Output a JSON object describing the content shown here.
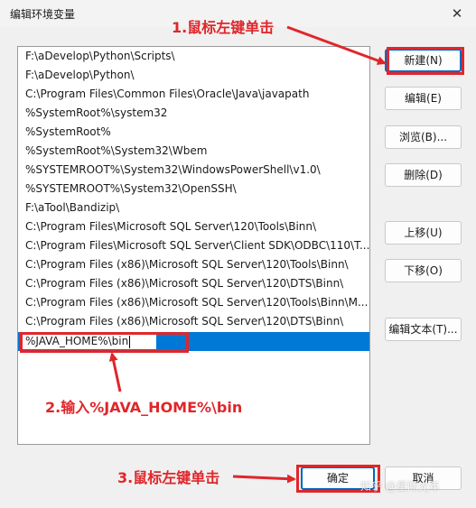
{
  "window": {
    "title": "编辑环境变量",
    "close_glyph": "✕"
  },
  "paths": [
    "F:\\aDevelop\\Python\\Scripts\\",
    "F:\\aDevelop\\Python\\",
    "C:\\Program Files\\Common Files\\Oracle\\Java\\javapath",
    "%SystemRoot%\\system32",
    "%SystemRoot%",
    "%SystemRoot%\\System32\\Wbem",
    "%SYSTEMROOT%\\System32\\WindowsPowerShell\\v1.0\\",
    "%SYSTEMROOT%\\System32\\OpenSSH\\",
    "F:\\aTool\\Bandizip\\",
    "C:\\Program Files\\Microsoft SQL Server\\120\\Tools\\Binn\\",
    "C:\\Program Files\\Microsoft SQL Server\\Client SDK\\ODBC\\110\\T...",
    "C:\\Program Files (x86)\\Microsoft SQL Server\\120\\Tools\\Binn\\",
    "C:\\Program Files (x86)\\Microsoft SQL Server\\120\\DTS\\Binn\\",
    "C:\\Program Files (x86)\\Microsoft SQL Server\\120\\Tools\\Binn\\M...",
    "C:\\Program Files (x86)\\Microsoft SQL Server\\120\\DTS\\Binn\\"
  ],
  "editing_row": {
    "value": "%JAVA_HOME%\\bin"
  },
  "buttons": {
    "new": "新建(N)",
    "edit": "编辑(E)",
    "browse": "浏览(B)...",
    "delete": "删除(D)",
    "move_up": "上移(U)",
    "move_down": "下移(O)",
    "edit_text": "编辑文本(T)...",
    "ok": "确定",
    "cancel": "取消"
  },
  "annotations": {
    "step1": "1.鼠标左键单击",
    "step2": "2.输入%JAVA_HOME%\\bin",
    "step3": "3.鼠标左键单击",
    "color": "#e0262a"
  },
  "watermark": "知乎 @星际光年"
}
